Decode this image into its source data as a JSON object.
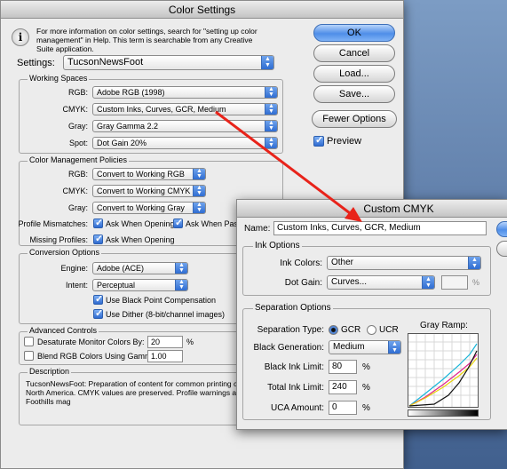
{
  "color_settings": {
    "title": "Color Settings",
    "info_text": "For more information on color settings, search for \"setting up color management\" in Help. This term is searchable from any Creative Suite application.",
    "settings_label": "Settings:",
    "settings_value": "TucsonNewsFoot",
    "working_spaces": {
      "title": "Working Spaces",
      "rgb_label": "RGB:",
      "rgb_value": "Adobe RGB (1998)",
      "cmyk_label": "CMYK:",
      "cmyk_value": "Custom Inks, Curves, GCR, Medium",
      "gray_label": "Gray:",
      "gray_value": "Gray Gamma 2.2",
      "spot_label": "Spot:",
      "spot_value": "Dot Gain 20%"
    },
    "policies": {
      "title": "Color Management Policies",
      "rgb_label": "RGB:",
      "rgb_value": "Convert to Working RGB",
      "cmyk_label": "CMYK:",
      "cmyk_value": "Convert to Working CMYK",
      "gray_label": "Gray:",
      "gray_value": "Convert to Working Gray",
      "mismatch_label": "Profile Mismatches:",
      "ask_opening": "Ask When Opening",
      "ask_pasting": "Ask When Pastin",
      "missing_label": "Missing Profiles:",
      "missing_ask": "Ask When Opening"
    },
    "conversion": {
      "title": "Conversion Options",
      "engine_label": "Engine:",
      "engine_value": "Adobe (ACE)",
      "intent_label": "Intent:",
      "intent_value": "Perceptual",
      "bpc_label": "Use Black Point Compensation",
      "dither_label": "Use Dither (8-bit/channel images)"
    },
    "advanced": {
      "title": "Advanced Controls",
      "desaturate_label": "Desaturate Monitor Colors By:",
      "desaturate_value": "20",
      "desaturate_unit": "%",
      "blend_label": "Blend RGB Colors Using Gamma:",
      "blend_value": "1.00"
    },
    "description": {
      "title": "Description",
      "lines": [
        "TucsonNewsFoot:  Preparation of content for common printing con",
        "North America. CMYK values are preserved. Profile warnings are en",
        "Foothills mag"
      ]
    },
    "buttons": {
      "ok": "OK",
      "cancel": "Cancel",
      "load": "Load...",
      "save": "Save...",
      "fewer": "Fewer Options",
      "preview": "Preview"
    }
  },
  "custom_cmyk": {
    "title": "Custom CMYK",
    "name_label": "Name:",
    "name_value": "Custom Inks, Curves, GCR, Medium",
    "ink_options": {
      "title": "Ink Options",
      "ink_colors_label": "Ink Colors:",
      "ink_colors_value": "Other",
      "dot_gain_label": "Dot Gain:",
      "dot_gain_value": "Curves...",
      "dot_gain_unit": "%"
    },
    "separation": {
      "title": "Separation Options",
      "type_label": "Separation Type:",
      "gcr": "GCR",
      "ucr": "UCR",
      "bg_label": "Black Generation:",
      "bg_value": "Medium",
      "black_limit_label": "Black Ink Limit:",
      "black_limit_value": "80",
      "total_limit_label": "Total Ink Limit:",
      "total_limit_value": "240",
      "uca_label": "UCA Amount:",
      "uca_value": "0",
      "unit": "%",
      "gray_ramp_label": "Gray Ramp:"
    }
  },
  "colors": {
    "arrow": "#e8231a",
    "cyan": "#17b5d8",
    "magenta": "#e0238c",
    "yellow": "#e8d20a",
    "black": "#111111"
  }
}
